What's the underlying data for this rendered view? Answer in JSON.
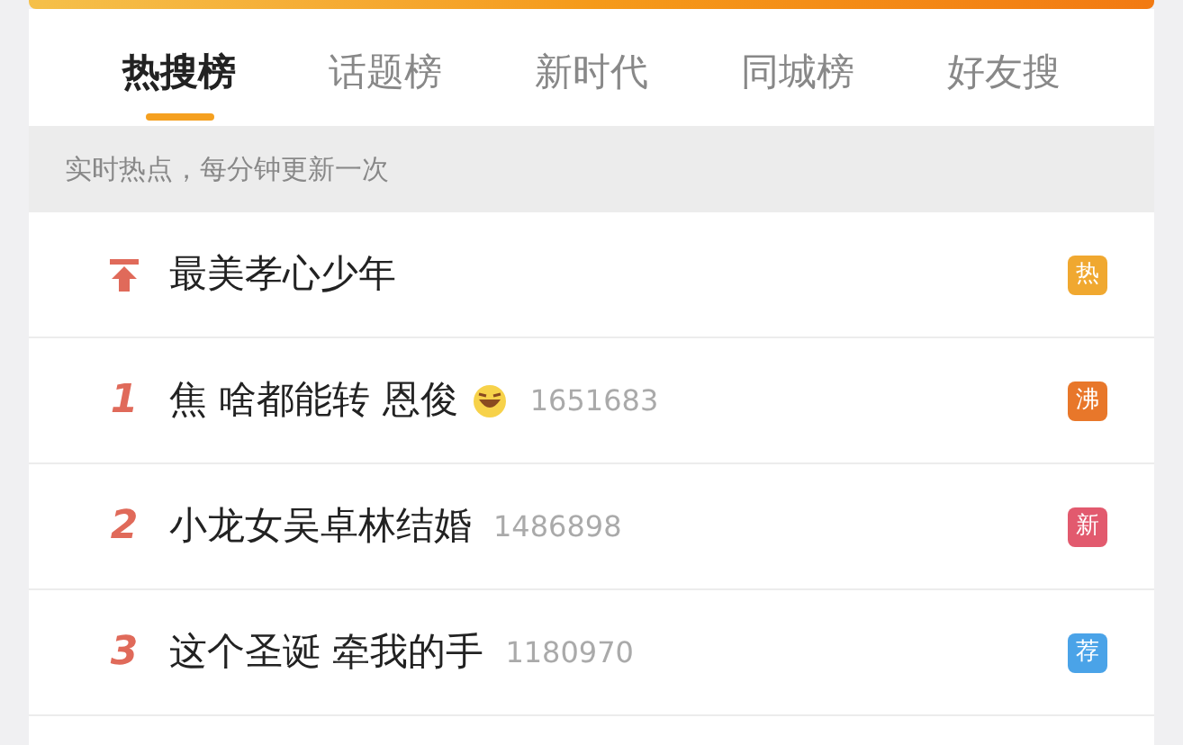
{
  "tabs": [
    {
      "label": "热搜榜",
      "selected": true
    },
    {
      "label": "话题榜",
      "selected": false
    },
    {
      "label": "新时代",
      "selected": false
    },
    {
      "label": "同城榜",
      "selected": false
    },
    {
      "label": "好友搜",
      "selected": false
    }
  ],
  "notice": "实时热点，每分钟更新一次",
  "rows": [
    {
      "kind": "pinned",
      "title": "最美孝心少年",
      "emoji": false,
      "badge": "热",
      "color": "#f0a830"
    },
    {
      "kind": "ranked",
      "rank": "1",
      "title": "焦 啥都能转 恩俊",
      "emoji": true,
      "count": "1651683",
      "badge": "沸",
      "color": "#e8772a"
    },
    {
      "kind": "ranked",
      "rank": "2",
      "title": "小龙女吴卓林结婚",
      "emoji": false,
      "count": "1486898",
      "badge": "新",
      "color": "#e25a6e"
    },
    {
      "kind": "ranked",
      "rank": "3",
      "title": "这个圣诞 牵我的手",
      "emoji": false,
      "count": "1180970",
      "badge": "荐",
      "color": "#4aa3e8"
    }
  ]
}
